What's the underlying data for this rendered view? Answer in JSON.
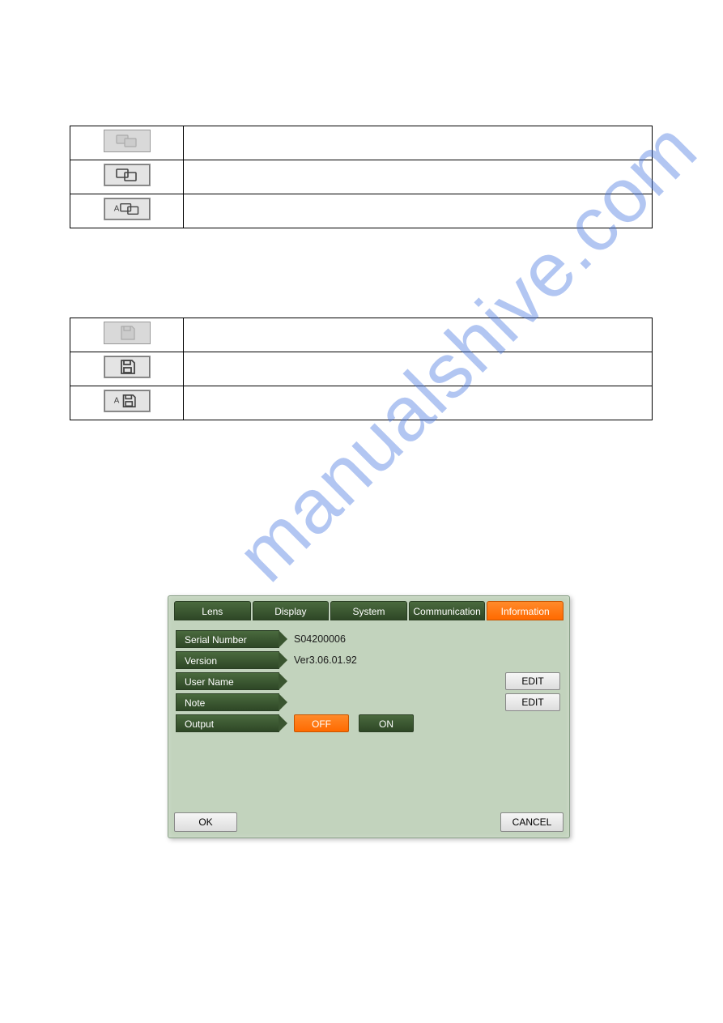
{
  "watermark": "manualshive.com",
  "table1": {
    "rows": [
      {
        "icon_name": "transfer-icon-disabled"
      },
      {
        "icon_name": "transfer-icon-enabled"
      },
      {
        "icon_name": "transfer-icon-auto"
      }
    ]
  },
  "table2": {
    "rows": [
      {
        "icon_name": "save-icon-disabled"
      },
      {
        "icon_name": "save-icon-enabled"
      },
      {
        "icon_name": "save-icon-auto"
      }
    ]
  },
  "dialog": {
    "tabs": [
      {
        "label": "Lens",
        "active": false
      },
      {
        "label": "Display",
        "active": false
      },
      {
        "label": "System",
        "active": false
      },
      {
        "label": "Communication",
        "active": false
      },
      {
        "label": "Information",
        "active": true
      }
    ],
    "fields": {
      "serial_label": "Serial Number",
      "serial_value": "S04200006",
      "version_label": "Version",
      "version_value": "Ver3.06.01.92",
      "username_label": "User Name",
      "username_value": "",
      "note_label": "Note",
      "note_value": "",
      "output_label": "Output",
      "output_off": "OFF",
      "output_on": "ON"
    },
    "edit_label": "EDIT",
    "ok_label": "OK",
    "cancel_label": "CANCEL"
  }
}
